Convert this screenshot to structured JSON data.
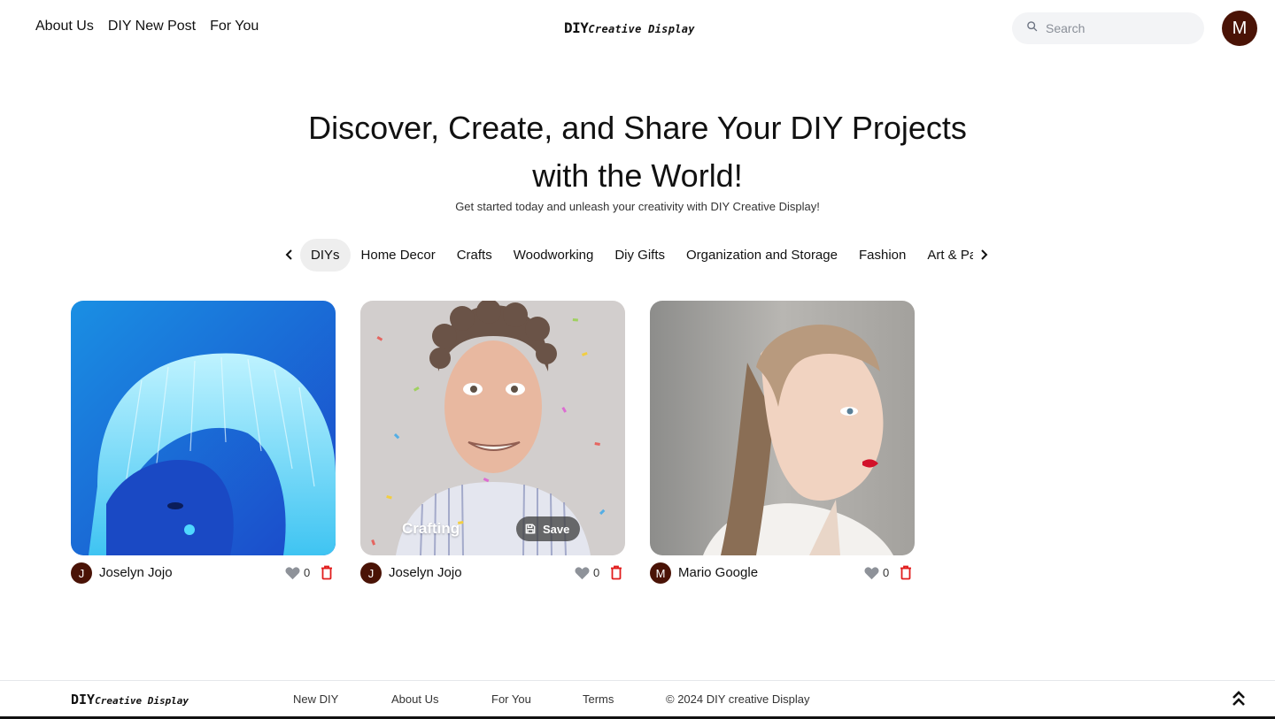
{
  "header": {
    "nav": [
      "About Us",
      "DIY New Post",
      "For You"
    ],
    "logo_big": "DIY",
    "logo_small": "Creative Display",
    "search_placeholder": "Search",
    "avatar_initial": "M"
  },
  "hero": {
    "title_line1": "Discover, Create, and Share Your DIY Projects",
    "title_line2": "with the World!",
    "subtitle": "Get started today and unleash your creativity with DIY Creative Display!"
  },
  "categories": {
    "items": [
      "DIYs",
      "Home Decor",
      "Crafts",
      "Woodworking",
      "Diy Gifts",
      "Organization and Storage",
      "Fashion",
      "Art & Painting"
    ],
    "active": "DIYs"
  },
  "cards": [
    {
      "author": "Joselyn Jojo",
      "initial": "J",
      "likes": "0"
    },
    {
      "author": "Joselyn Jojo",
      "initial": "J",
      "likes": "0",
      "hover_label": "Crafting",
      "save_label": "Save"
    },
    {
      "author": "Mario Google",
      "initial": "M",
      "likes": "0"
    }
  ],
  "footer": {
    "logo_big": "DIY",
    "logo_small": "Creative Display",
    "links": [
      "New DIY",
      "About Us",
      "For You",
      "Terms"
    ],
    "copyright": "© 2024 DIY creative Display"
  },
  "colors": {
    "avatar_bg": "#4a1306",
    "trash": "#e11d1d",
    "heart": "#8e9299"
  },
  "icons": [
    "search-icon",
    "chevron-left-icon",
    "chevron-right-icon",
    "heart-icon",
    "trash-icon",
    "save-icon",
    "double-chevron-up-icon"
  ]
}
